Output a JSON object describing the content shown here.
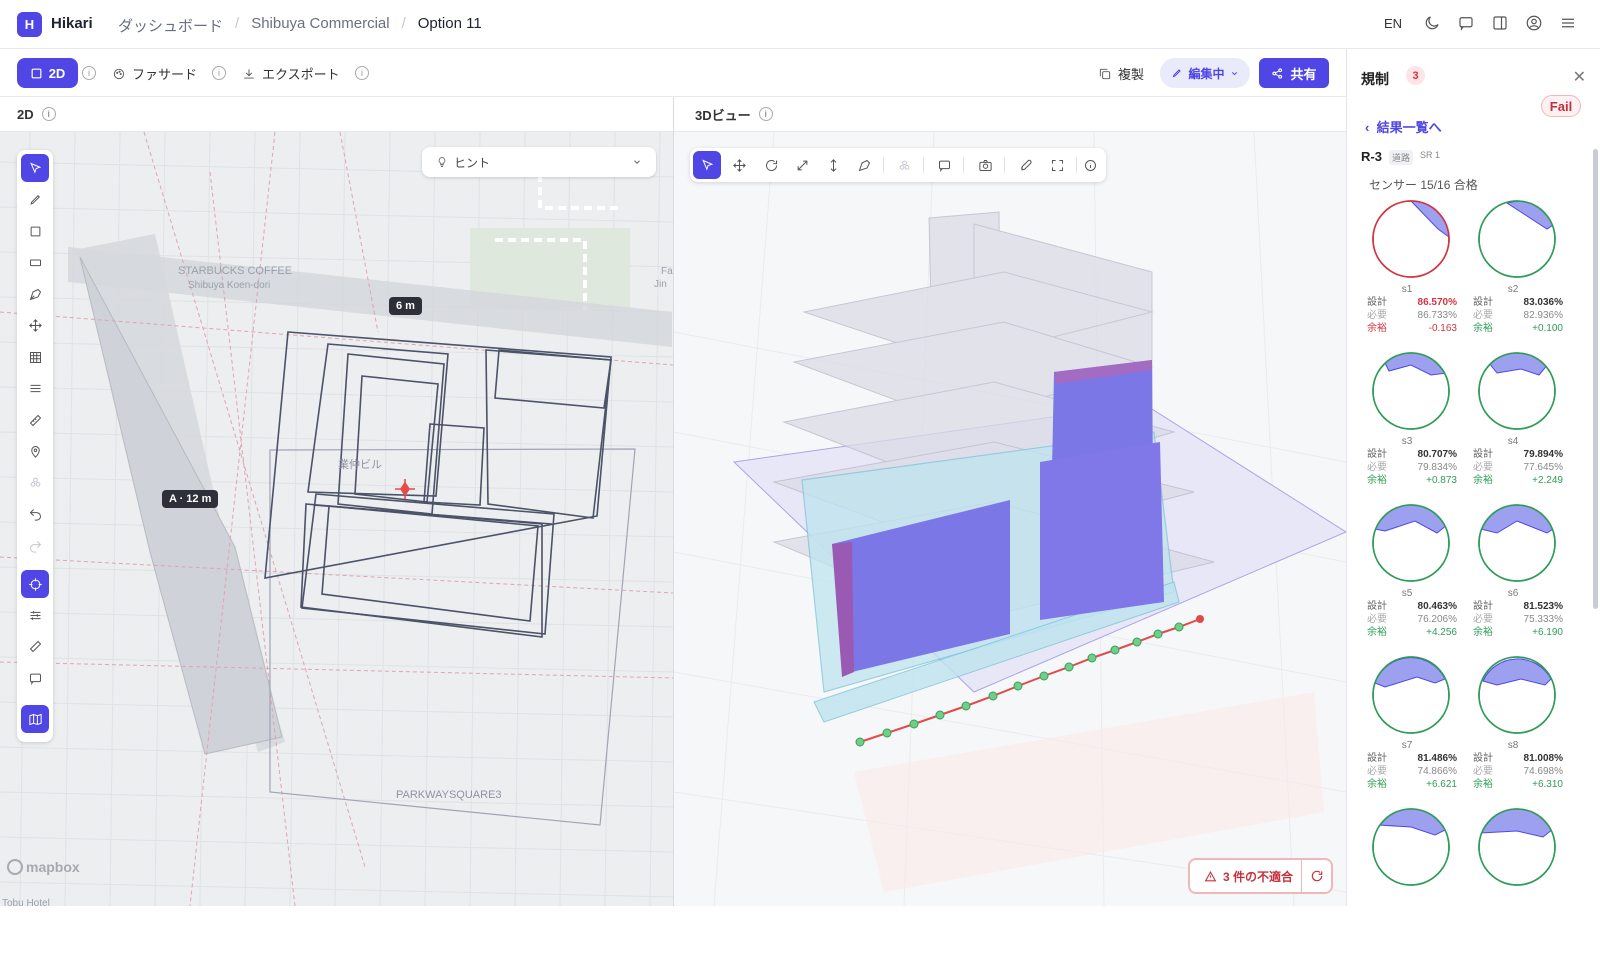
{
  "app": {
    "logo_letter": "H",
    "name": "Hikari"
  },
  "breadcrumb": [
    "ダッシュボード",
    "Shibuya Commercial",
    "Option 11"
  ],
  "topbar": {
    "lang": "EN"
  },
  "toolbar": {
    "mode_2d": "2D",
    "facade": "ファサード",
    "export": "エクスポート",
    "duplicate": "複製",
    "editing": "編集中",
    "share": "共有"
  },
  "panels": {
    "left_title": "2D",
    "right_title": "3Dビュー"
  },
  "map2d": {
    "hint_label": "ヒント",
    "dimension_chip": "6 m",
    "road_chip": "A · 12 m",
    "labels": [
      "STARBUCKS COFFEE",
      "Shibuya Koen-dori",
      "業仲ビル",
      "PARKWAYSQUARE3",
      "Tobu Hotel",
      "Fa",
      "Jin"
    ],
    "attribution": "mapbox"
  },
  "view3d": {
    "nonconformity": "3 件の不適合"
  },
  "regulation": {
    "title": "規制",
    "count": "3",
    "back": "結果一覧へ",
    "rule_id": "R-3",
    "rule_tag": "道路",
    "rule_sub": "SR 1",
    "status": "Fail",
    "summary": "センサー 15/16 合格",
    "row_labels": {
      "design": "設計",
      "required": "必要",
      "margin": "余裕"
    },
    "colors": {
      "fail": "#d33440",
      "pass": "#2e9d57",
      "fill": "#7b80e8"
    },
    "sensors": [
      {
        "name": "s1",
        "design": "86.570%",
        "required": "86.733%",
        "margin": "-0.163",
        "pass": false
      },
      {
        "name": "s2",
        "design": "83.036%",
        "required": "82.936%",
        "margin": "+0.100",
        "pass": true
      },
      {
        "name": "s3",
        "design": "80.707%",
        "required": "79.834%",
        "margin": "+0.873",
        "pass": true
      },
      {
        "name": "s4",
        "design": "79.894%",
        "required": "77.645%",
        "margin": "+2.249",
        "pass": true
      },
      {
        "name": "s5",
        "design": "80.463%",
        "required": "76.206%",
        "margin": "+4.256",
        "pass": true
      },
      {
        "name": "s6",
        "design": "81.523%",
        "required": "75.333%",
        "margin": "+6.190",
        "pass": true
      },
      {
        "name": "s7",
        "design": "81.486%",
        "required": "74.866%",
        "margin": "+6.621",
        "pass": true
      },
      {
        "name": "s8",
        "design": "81.008%",
        "required": "74.698%",
        "margin": "+6.310",
        "pass": true
      },
      {
        "name": "",
        "pass": true
      },
      {
        "name": "",
        "pass": true
      }
    ]
  }
}
